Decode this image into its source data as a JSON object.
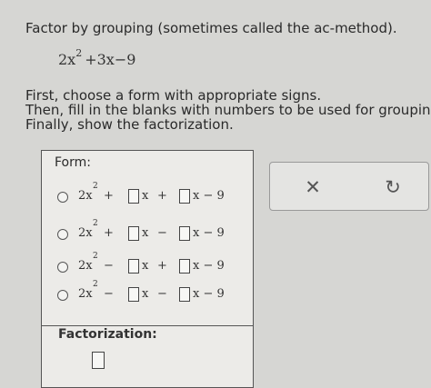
{
  "header": {
    "instruction": "Factor by grouping (sometimes called the ac-method).",
    "expr_lead": "2x",
    "expr_exp": "2",
    "expr_tail": "+3x−9"
  },
  "steps": [
    "First, choose a form with appropriate signs.",
    "Then, fill in the blanks with numbers to be used for grouping.",
    "Finally, show the factorization."
  ],
  "form": {
    "label": "Form:",
    "options": [
      {
        "lead": "2x",
        "exp": "2",
        "op1": "+",
        "x_label": "x",
        "op2": "+",
        "tail": "x − 9"
      },
      {
        "lead": "2x",
        "exp": "2",
        "op1": "+",
        "x_label": "x",
        "op2": "−",
        "tail": "x − 9"
      },
      {
        "lead": "2x",
        "exp": "2",
        "op1": "−",
        "x_label": "x",
        "op2": "+",
        "tail": "x − 9"
      },
      {
        "lead": "2x",
        "exp": "2",
        "op1": "−",
        "x_label": "x",
        "op2": "−",
        "tail": "x − 9"
      }
    ]
  },
  "factorization": {
    "label": "Factorization:"
  },
  "actions": {
    "clear_icon": "✕",
    "undo_icon": "↻"
  }
}
